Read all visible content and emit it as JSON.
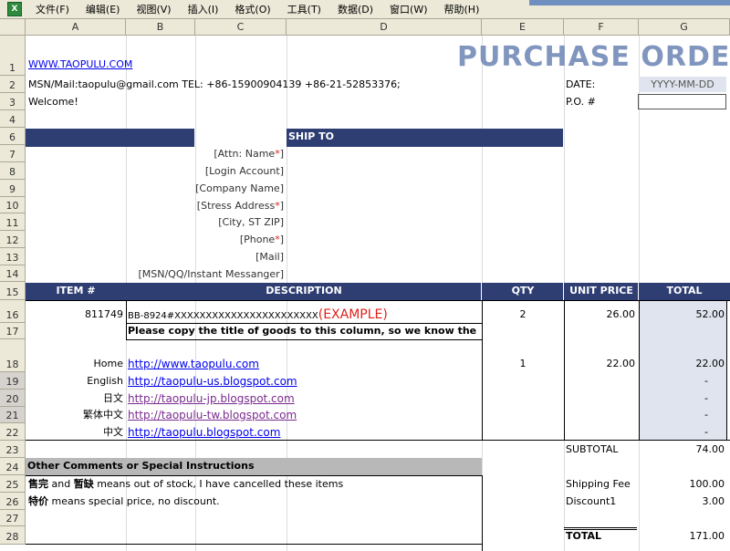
{
  "app_icon_text": "X",
  "menu": [
    "文件(F)",
    "编辑(E)",
    "视图(V)",
    "插入(I)",
    "格式(O)",
    "工具(T)",
    "数据(D)",
    "窗口(W)",
    "帮助(H)"
  ],
  "columns": [
    "A",
    "B",
    "C",
    "D",
    "E",
    "F",
    "G"
  ],
  "rows": [
    "1",
    "2",
    "3",
    "4",
    "6",
    "7",
    "8",
    "9",
    "10",
    "11",
    "12",
    "13",
    "14",
    "15",
    "16",
    "17",
    "18",
    "19",
    "20",
    "21",
    "22",
    "23",
    "24",
    "25",
    "26",
    "27",
    "28"
  ],
  "header": {
    "website": "WWW.TAOPULU.COM",
    "title": "PURCHASE ORDER",
    "contact": "MSN/Mail:taopulu@gmail.com  TEL: +86-15900904139 +86-21-52853376;",
    "welcome": "Welcome!",
    "date_label": "DATE:",
    "date_value": "YYYY-MM-DD",
    "po_label": "P.O. #"
  },
  "ship_to": {
    "heading": "SHIP TO",
    "fields": [
      {
        "label": "[Attn: Name",
        "req": "*",
        "end": "]"
      },
      {
        "label": "[Login Account",
        "req": "",
        "end": "]"
      },
      {
        "label": "[Company Name",
        "req": "",
        "end": "]"
      },
      {
        "label": "[Stress Address",
        "req": "*",
        "end": "]"
      },
      {
        "label": "[City, ST  ZIP",
        "req": "",
        "end": "]"
      },
      {
        "label": "[Phone",
        "req": "*",
        "end": "]"
      },
      {
        "label": "[Mail",
        "req": "",
        "end": "]"
      },
      {
        "label": "[MSN/QQ/Instant Messanger",
        "req": "",
        "end": "]"
      }
    ]
  },
  "table": {
    "headers": [
      "ITEM #",
      "DESCRIPTION",
      "QTY",
      "UNIT PRICE",
      "TOTAL"
    ],
    "row16": {
      "item": "811749",
      "desc": "BB-8924#XXXXXXXXXXXXXXXXXXXXXXX",
      "example": "(EXAMPLE)",
      "qty": "2",
      "price": "26.00",
      "total": "52.00"
    },
    "row17_note": "Please copy the title of goods to this column, so we know the",
    "row18": {
      "label": "Home",
      "link": "http://www.taopulu.com",
      "qty": "1",
      "price": "22.00",
      "total": "22.00"
    },
    "links": [
      {
        "label": "English",
        "url": "http://taopulu-us.blogspot.com",
        "total": "-"
      },
      {
        "label": "日文",
        "url": "http://taopulu-jp.blogspot.com",
        "total": "-"
      },
      {
        "label": "繁体中文",
        "url": "http://taopulu-tw.blogspot.com",
        "total": "-"
      },
      {
        "label": "中文",
        "url": "http://taopulu.blogspot.com",
        "total": "-"
      }
    ]
  },
  "totals": {
    "subtotal_label": "SUBTOTAL",
    "subtotal": "74.00",
    "shipping_label": "Shipping Fee",
    "shipping": "100.00",
    "discount_label": "Discount1",
    "discount": "3.00",
    "total_label": "TOTAL",
    "total": "171.00"
  },
  "comments": {
    "heading": "Other Comments or Special Instructions",
    "line1_bold1": "售完",
    "line1_mid": " and ",
    "line1_bold2": "暂缺",
    "line1_rest": " means out of stock,  I have cancelled these items",
    "line2_bold": "特价",
    "line2_rest": " means special price, no discount."
  },
  "colors": {
    "band": "#2E3E73",
    "title": "#8096BE",
    "shade": "#E0E4EE",
    "required": "#E0201B"
  }
}
